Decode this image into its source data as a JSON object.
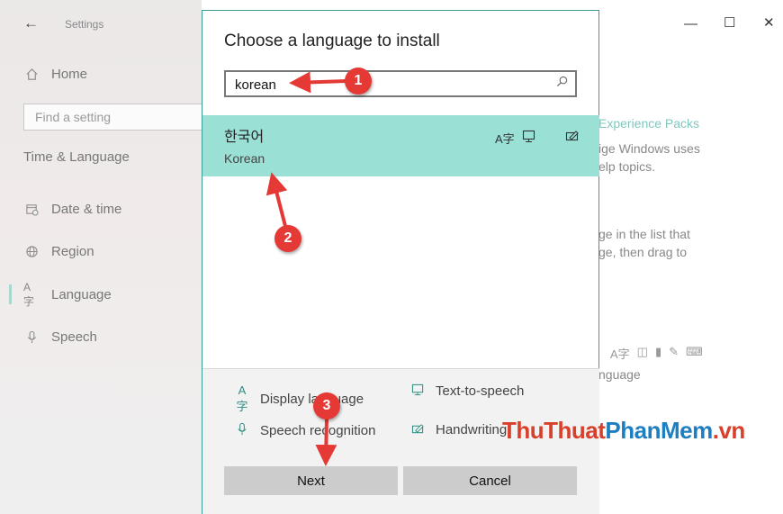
{
  "settings": {
    "app_title": "Settings",
    "home_label": "Home",
    "search_placeholder": "Find a setting",
    "section_title": "Time & Language",
    "nav": [
      {
        "label": "Date & time",
        "icon": "calendar-clock-icon"
      },
      {
        "label": "Region",
        "icon": "globe-icon"
      },
      {
        "label": "Language",
        "icon": "language-icon",
        "active": true
      },
      {
        "label": "Speech",
        "icon": "microphone-icon"
      }
    ]
  },
  "background": {
    "link": "Experience Packs",
    "text1_a": "ige Windows uses",
    "text1_b": "elp topics.",
    "text2_a": "ge in the list that",
    "text2_b": "ge, then drag to",
    "text3": "nguage"
  },
  "dialog": {
    "title": "Choose a language to install",
    "search_value": "korean",
    "result": {
      "native": "한국어",
      "english": "Korean"
    },
    "legend": [
      {
        "label": "Display language",
        "icon": "display-language-icon"
      },
      {
        "label": "Text-to-speech",
        "icon": "text-to-speech-icon"
      },
      {
        "label": "Speech recognition",
        "icon": "speech-recognition-icon"
      },
      {
        "label": "Handwriting",
        "icon": "handwriting-icon"
      }
    ],
    "next_label": "Next",
    "cancel_label": "Cancel"
  },
  "annotations": {
    "step1": "1",
    "step2": "2",
    "step3": "3"
  },
  "watermark": {
    "part1": "ThuThuat",
    "part2": "PhanMem",
    "part3": ".vn"
  },
  "colors": {
    "accent": "#3a9d93",
    "selected_row": "#9ae0d5",
    "badge": "#e53935"
  }
}
